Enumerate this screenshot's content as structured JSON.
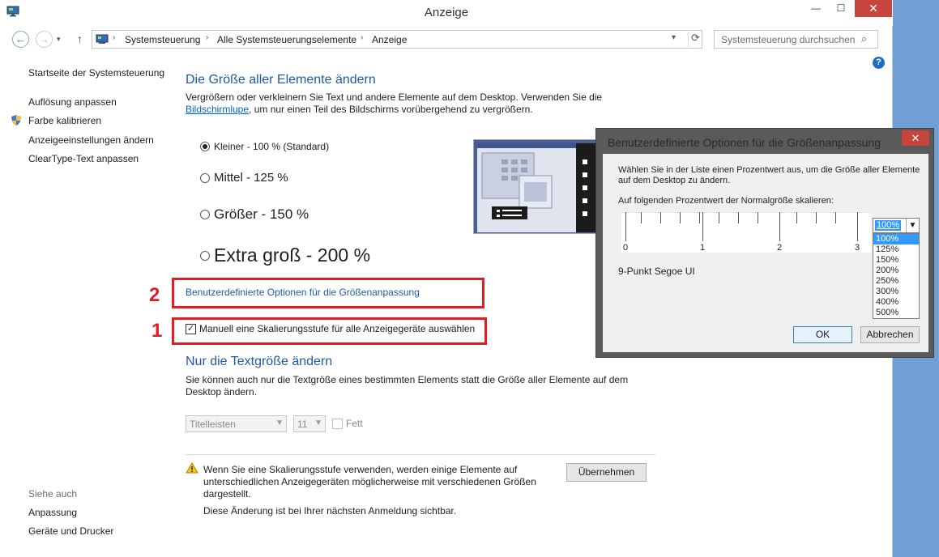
{
  "window": {
    "title": "Anzeige"
  },
  "window_controls": {
    "minimize": "—",
    "maximize": "☐",
    "close": "✕"
  },
  "nav": {
    "back": "←",
    "forward": "→",
    "up": "↑",
    "dropdown": "▾"
  },
  "breadcrumb": [
    "Systemsteuerung",
    "Alle Systemsteuerungselemente",
    "Anzeige"
  ],
  "breadcrumb_sep": "›",
  "search": {
    "placeholder": "Systemsteuerung durchsuchen"
  },
  "sidebar": {
    "items": [
      {
        "label": "Startseite der Systemsteuerung"
      },
      {
        "label": "Auflösung anpassen"
      },
      {
        "label": "Farbe kalibrieren"
      },
      {
        "label": "Anzeigeeinstellungen ändern"
      },
      {
        "label": "ClearType-Text anpassen"
      }
    ],
    "see_also_header": "Siehe auch",
    "see_also": [
      {
        "label": "Anpassung"
      },
      {
        "label": "Geräte und Drucker"
      }
    ]
  },
  "main": {
    "heading": "Die Größe aller Elemente ändern",
    "intro_1": "Vergrößern oder verkleinern Sie Text und andere Elemente auf dem Desktop. Verwenden Sie die",
    "intro_link": "Bildschirmlupe",
    "intro_2": ", um nur einen Teil des Bildschirms vorübergehend zu vergrößern.",
    "options": [
      {
        "label": "Kleiner - 100 % (Standard)",
        "selected": true
      },
      {
        "label": "Mittel - 125 %",
        "selected": false
      },
      {
        "label": "Größer - 150 %",
        "selected": false
      },
      {
        "label": "Extra groß - 200 %",
        "selected": false
      }
    ],
    "custom_link": "Benutzerdefinierte Optionen für die Größenanpassung",
    "manual_checkbox": {
      "label": "Manuell eine Skalierungsstufe für alle Anzeigegeräte auswählen",
      "checked": true
    },
    "annotation_1": "1",
    "annotation_2": "2",
    "text_heading": "Nur die Textgröße ändern",
    "text_desc_1": "Sie können auch nur die Textgröße eines bestimmten Elements statt die Größe aller Elemente auf dem",
    "text_desc_2": "Desktop ändern.",
    "element_select": "Titelleisten",
    "size_select": "11",
    "bold_label": "Fett",
    "warning_1": "Wenn Sie eine Skalierungsstufe verwenden, werden einige Elemente auf",
    "warning_2": "unterschiedlichen Anzeigegeräten möglicherweise mit verschiedenen Größen",
    "warning_3": "dargestellt.",
    "note": "Diese Änderung ist bei Ihrer nächsten Anmeldung sichtbar.",
    "apply_button": "Übernehmen"
  },
  "dialog": {
    "title": "Benutzerdefinierte Optionen für die Größenanpassung",
    "close": "✕",
    "instruction_1": "Wählen Sie in der Liste einen Prozentwert aus, um die Größe aller Elemente",
    "instruction_2": "auf dem Desktop zu ändern.",
    "scale_label": "Auf folgenden Prozentwert der Normalgröße skalieren:",
    "scale_value": "100%",
    "scale_options": [
      "100%",
      "125%",
      "150%",
      "200%",
      "250%",
      "300%",
      "400%",
      "500%"
    ],
    "ruler_labels": [
      "0",
      "1",
      "2",
      "3"
    ],
    "font_sample": "9-Punkt Segoe UI",
    "ok": "OK",
    "cancel": "Abbrechen"
  },
  "colors": {
    "accent": "#1e5aa7",
    "link": "#0066cc",
    "annotation": "#e21c24",
    "close": "#c7453c"
  }
}
